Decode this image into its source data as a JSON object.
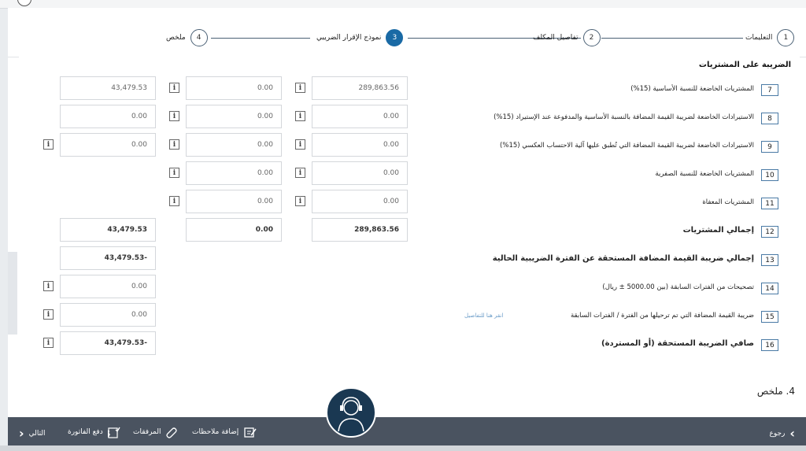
{
  "stepper": {
    "steps": [
      {
        "num": "1",
        "label": "التعليمات"
      },
      {
        "num": "2",
        "label": "تفاصيل المكلف"
      },
      {
        "num": "3",
        "label": "نموذج الإقرار الضريبي"
      },
      {
        "num": "4",
        "label": "ملخص"
      }
    ],
    "active_index": 2
  },
  "section": {
    "title": "الضريبة على المشتريات"
  },
  "rows": [
    {
      "num": "7",
      "label": "المشتريات الخاضعة للنسبة الأساسية (15%)",
      "v1": "289,863.56",
      "v2": "0.00",
      "v3": "43,479.53"
    },
    {
      "num": "8",
      "label": "الاستيرادات الخاضعة لضريبة القيمة المضافة بالنسبة الأساسية والمدفوعة عند الإستيراد (15%)",
      "v1": "0.00",
      "v2": "0.00",
      "v3": "0.00"
    },
    {
      "num": "9",
      "label": "الاستيرادات الخاضعة لضريبة القيمة المضافة التي تُطبق عليها آلية الاحتساب العكسي (15%)",
      "v1": "0.00",
      "v2": "0.00",
      "v3": "0.00"
    },
    {
      "num": "10",
      "label": "المشتريات الخاضعة للنسبة الصفرية",
      "v1": "0.00",
      "v2": "0.00"
    },
    {
      "num": "11",
      "label": "المشتريات المعفاة",
      "v1": "0.00",
      "v2": "0.00"
    },
    {
      "num": "12",
      "label": "إجمالي المشتريات",
      "v1": "289,863.56",
      "v2": "0.00",
      "v3": "43,479.53"
    },
    {
      "num": "13",
      "label": "إجمالي ضريبة القيمة المضافة المستحقة عن الفترة الضريبية الحالية",
      "v3": "43,479.53-"
    },
    {
      "num": "14",
      "label": "تصحيحات من الفترات السابقة (بين 5000.00 ± ريال)",
      "v3": "0.00"
    },
    {
      "num": "15",
      "label": "ضريبة القيمة المضافة التي تم ترحيلها من الفترة / الفترات السابقة",
      "link": "انقر هنا للتفاصيل",
      "v3": "0.00"
    },
    {
      "num": "16",
      "label": "صافي الضريبة المستحقة (أو المستردة)",
      "v3": "43,479.53-"
    }
  ],
  "summary_heading": "4. ملخص",
  "bottombar": {
    "back": "رجوع",
    "add_notes": "إضافة ملاحظات",
    "attachments": "المرفقات",
    "pay_invoice": "دفع الفاتورة",
    "next": "التالي"
  },
  "icons": {
    "info": "info-icon",
    "chevron_left": "chevron-left-icon",
    "chevron_right": "chevron-right-icon",
    "notes": "edit-note-icon",
    "clip": "paperclip-icon",
    "pay": "invoice-pay-icon",
    "assistant": "headset-avatar-icon"
  },
  "colors": {
    "accent": "#1a6aa5",
    "bar": "#4a5360",
    "link": "#6a9cc8"
  }
}
